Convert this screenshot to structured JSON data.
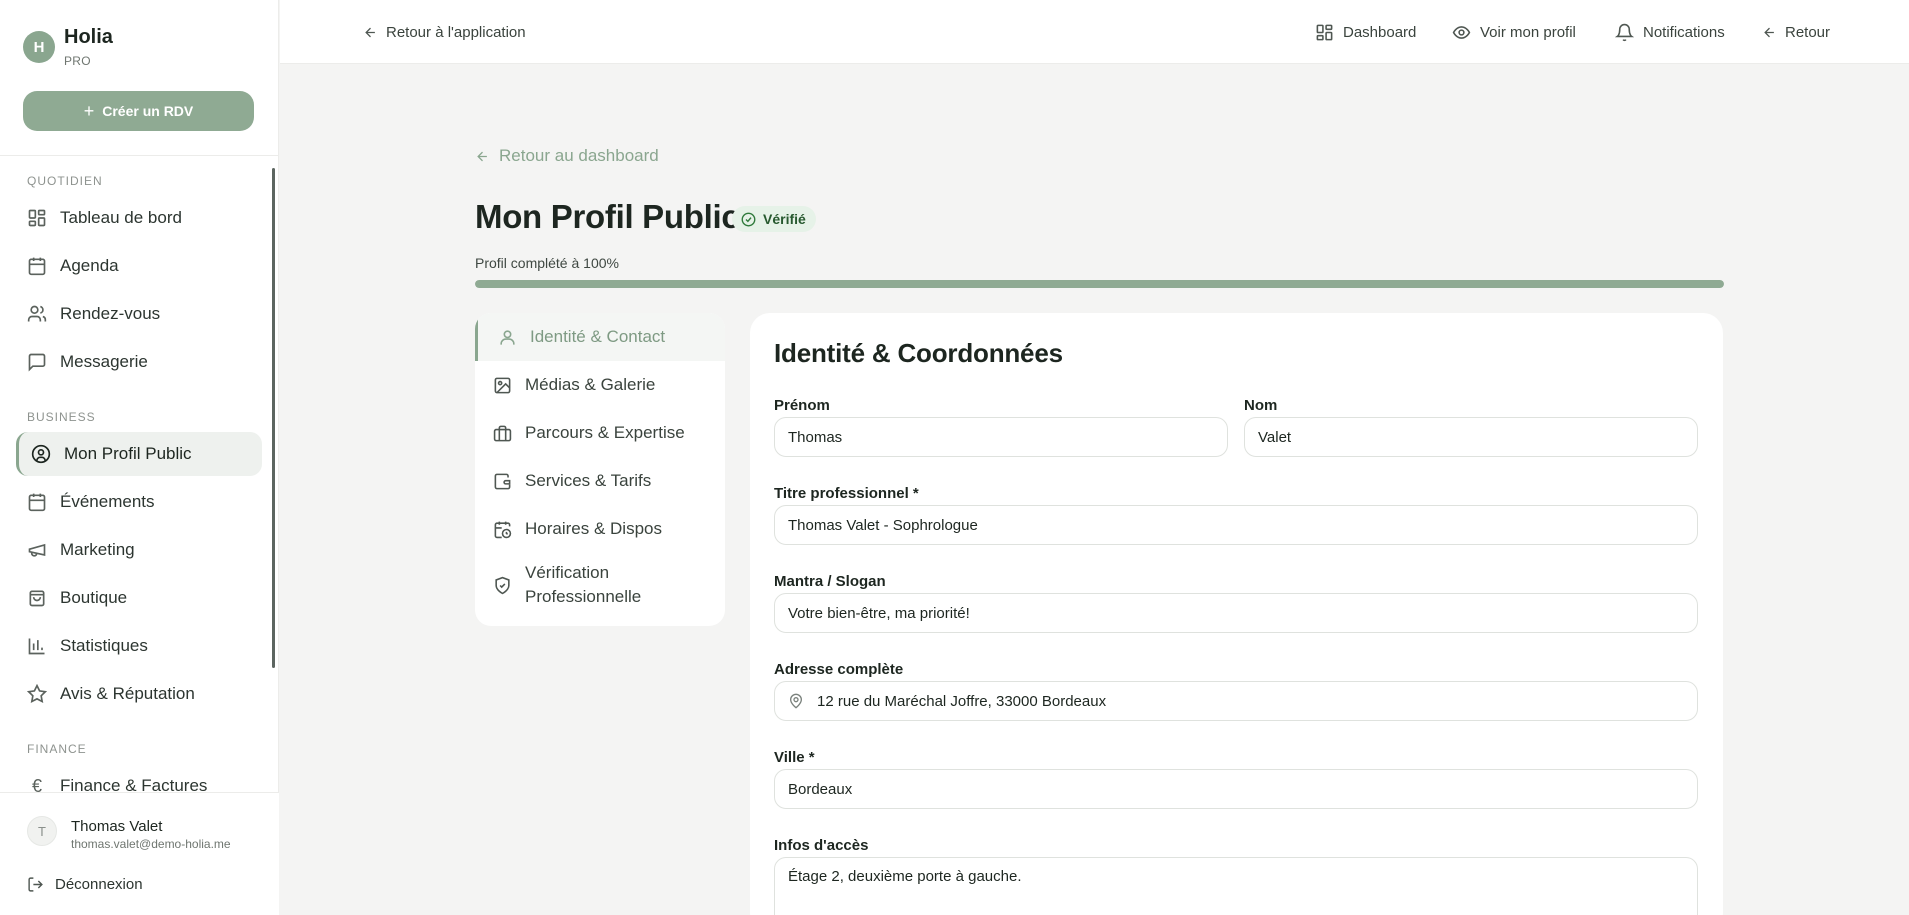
{
  "app": {
    "name": "Holia",
    "tier": "PRO",
    "initial": "H"
  },
  "sidebar": {
    "create_button": "Créer un RDV",
    "sections": [
      {
        "label": "QUOTIDIEN"
      },
      {
        "label": "BUSINESS"
      },
      {
        "label": "FINANCE"
      }
    ],
    "items": [
      {
        "label": "Tableau de bord",
        "icon": "dashboard-icon"
      },
      {
        "label": "Agenda",
        "icon": "calendar-icon"
      },
      {
        "label": "Rendez-vous",
        "icon": "users-icon"
      },
      {
        "label": "Messagerie",
        "icon": "message-icon"
      },
      {
        "label": "Mon Profil Public",
        "icon": "user-circle-icon",
        "active": true
      },
      {
        "label": "Événements",
        "icon": "calendar-days-icon"
      },
      {
        "label": "Marketing",
        "icon": "megaphone-icon"
      },
      {
        "label": "Boutique",
        "icon": "shopping-bag-icon"
      },
      {
        "label": "Statistiques",
        "icon": "bar-chart-icon"
      },
      {
        "label": "Avis & Réputation",
        "icon": "star-icon"
      },
      {
        "label": "Finance & Factures",
        "icon": "euro-icon"
      }
    ],
    "user": {
      "initial": "T",
      "name": "Thomas Valet",
      "email": "thomas.valet@demo-holia.me"
    },
    "logout": "Déconnexion"
  },
  "topbar": {
    "back_app": "Retour à l'application",
    "dashboard": "Dashboard",
    "view_profile": "Voir mon profil",
    "notifications": "Notifications",
    "back": "Retour"
  },
  "main": {
    "back_dashboard": "Retour au dashboard",
    "title": "Mon Profil Public",
    "badge": "Vérifié",
    "progress_label": "Profil complété à 100%",
    "progress_value": 1.0,
    "tabs": [
      {
        "label": "Identité & Contact",
        "icon": "user-icon",
        "active": true
      },
      {
        "label": "Médias & Galerie",
        "icon": "image-icon"
      },
      {
        "label": "Parcours & Expertise",
        "icon": "briefcase-icon"
      },
      {
        "label": "Services & Tarifs",
        "icon": "wallet-icon"
      },
      {
        "label": "Horaires & Dispos",
        "icon": "calendar-clock-icon"
      },
      {
        "label_line1": "Vérification",
        "label_line2": "Professionnelle",
        "icon": "shield-check-icon"
      }
    ],
    "form": {
      "title": "Identité & Coordonnées",
      "first_name": {
        "label": "Prénom",
        "value": "Thomas"
      },
      "last_name": {
        "label": "Nom",
        "value": "Valet"
      },
      "job_title": {
        "label": "Titre professionnel *",
        "value": "Thomas Valet - Sophrologue"
      },
      "mantra": {
        "label": "Mantra / Slogan",
        "value": "Votre bien-être, ma priorité!"
      },
      "address": {
        "label": "Adresse complète",
        "value": "12 rue du Maréchal Joffre, 33000 Bordeaux"
      },
      "city": {
        "label": "Ville *",
        "value": "Bordeaux"
      },
      "access": {
        "label": "Infos d'accès",
        "value": "Étage 2, deuxième porte à gauche."
      }
    }
  },
  "colors": {
    "accent": "#8faa93",
    "verified_bg": "#e6f2e8",
    "verified_text": "#27592f"
  }
}
